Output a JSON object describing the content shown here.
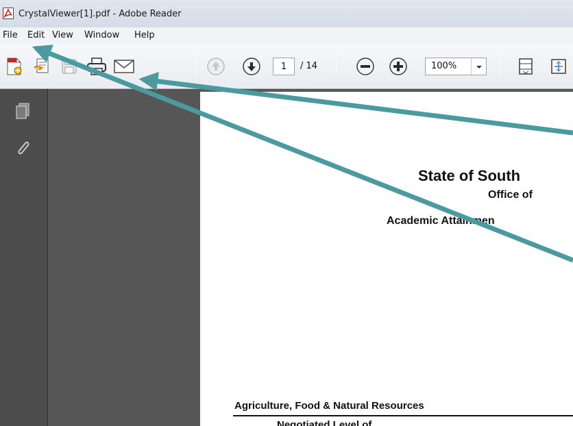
{
  "window": {
    "title": "CrystalViewer[1].pdf - Adobe Reader",
    "app_icon": "adobe-reader-icon"
  },
  "menubar": {
    "items": [
      "File",
      "Edit",
      "View",
      "Window",
      "Help"
    ]
  },
  "toolbar": {
    "icons": [
      "create-pdf-icon",
      "export-icon",
      "save-icon",
      "print-icon",
      "email-icon",
      "previous-page-icon",
      "next-page-icon",
      "zoom-out-icon",
      "zoom-in-icon",
      "fit-page-icon",
      "full-screen-icon"
    ],
    "page_number": "1",
    "page_total": "/ 14",
    "zoom": "100%"
  },
  "navpane": {
    "icons": [
      "pages-icon",
      "attachments-icon"
    ]
  },
  "document": {
    "title": "State of South",
    "subtitle": "Office of",
    "line3": "Academic Attainmen",
    "section_heading": "Agriculture, Food & Natural Resources",
    "cut_text": "Negotiated Level of"
  },
  "annotations": {
    "arrow_color": "#4a9aa0"
  }
}
